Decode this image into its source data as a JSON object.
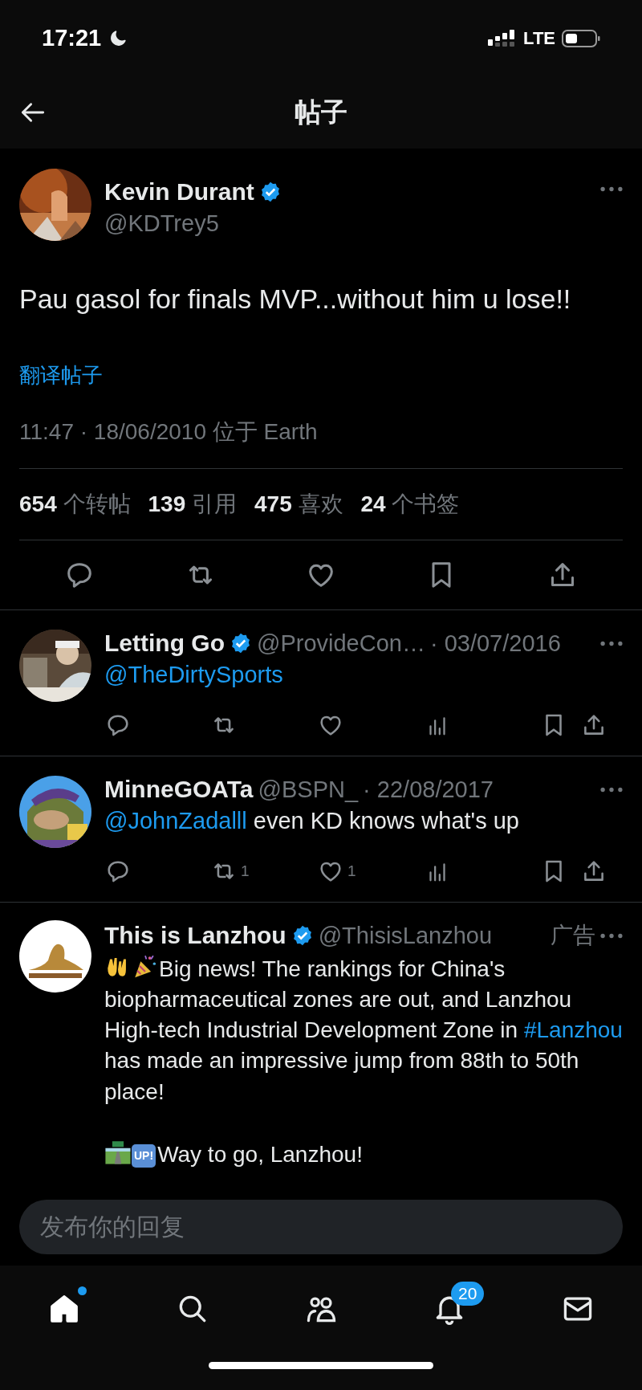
{
  "status_bar": {
    "time": "17:21",
    "network": "LTE"
  },
  "header": {
    "title": "帖子"
  },
  "tweet": {
    "author": {
      "name": "Kevin Durant",
      "handle": "@KDTrey5",
      "verified": true
    },
    "text": "Pau gasol for finals MVP...without him u lose!!",
    "translate": "翻译帖子",
    "meta": "11:47 · 18/06/2010 位于 Earth",
    "stats": [
      {
        "count": "654",
        "label": "个转帖"
      },
      {
        "count": "139",
        "label": "引用"
      },
      {
        "count": "475",
        "label": "喜欢"
      },
      {
        "count": "24",
        "label": "个书签"
      }
    ]
  },
  "replies": [
    {
      "name": "Letting Go",
      "verified": true,
      "handle": "@ProvideCon…",
      "date": "· 03/07/2016",
      "parts": [
        {
          "kind": "mention",
          "text": "@TheDirtySports"
        }
      ]
    },
    {
      "name": "MinneGOATa",
      "verified": false,
      "handle": "@BSPN_",
      "date": "· 22/08/2017",
      "parts": [
        {
          "kind": "mention",
          "text": "@JohnZadalll"
        },
        {
          "kind": "text",
          "text": " even KD knows what's up"
        }
      ],
      "retweets": "1",
      "likes": "1"
    }
  ],
  "ad": {
    "name": "This is Lanzhou",
    "verified": true,
    "handle": "@ThisisLanzhou",
    "label": "广告",
    "paragraphs": [
      {
        "parts": [
          {
            "kind": "emoji"
          },
          {
            "kind": "emoji"
          },
          {
            "kind": "text",
            "text": "Big news! The rankings for China's biopharmaceutical zones are out, and Lanzhou High-tech Industrial Development Zone in "
          },
          {
            "kind": "hashtag",
            "text": "#Lanzhou"
          },
          {
            "kind": "text",
            "text": " has made an impressive jump from 88th to 50th place!"
          }
        ]
      },
      {
        "parts": [
          {
            "kind": "emoji"
          },
          {
            "kind": "badge",
            "text": "UP!"
          },
          {
            "kind": "text",
            "text": "Way to go, Lanzhou!"
          }
        ]
      }
    ]
  },
  "reply_box": {
    "placeholder": "发布你的回复"
  },
  "tabs": [
    {
      "selected": true,
      "unread_dot": true
    },
    {
      "selected": false,
      "unread_dot": false
    },
    {
      "selected": false,
      "unread_dot": false
    },
    {
      "selected": false,
      "unread_dot": false,
      "badge": "20"
    },
    {
      "selected": false,
      "unread_dot": false
    }
  ]
}
